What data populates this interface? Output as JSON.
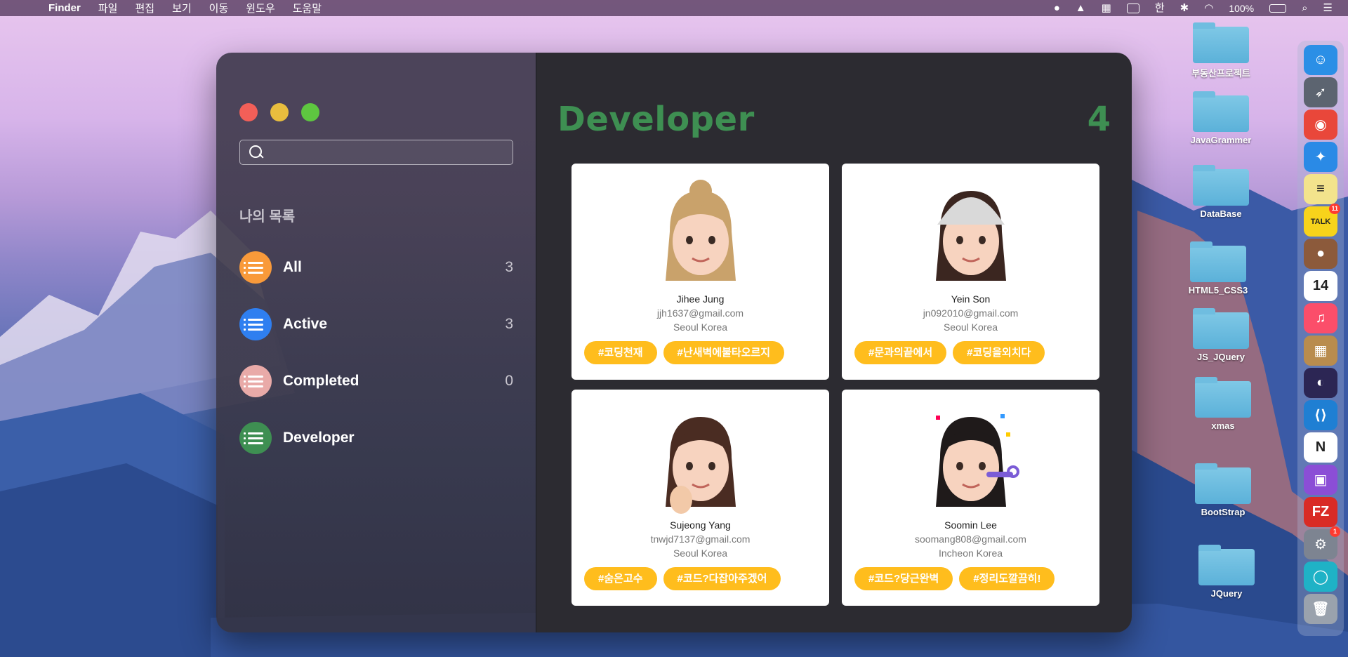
{
  "menubar": {
    "app_name": "Finder",
    "menus": [
      "파일",
      "편집",
      "보기",
      "이동",
      "윈도우",
      "도움말"
    ],
    "status": {
      "input_method": "한",
      "battery": "100%"
    }
  },
  "desktop": {
    "items": [
      {
        "label": "부동산프로젝트"
      },
      {
        "label": "JavaGrammer"
      },
      {
        "label": "DataBase"
      },
      {
        "label": "HTML5_CSS3"
      },
      {
        "label": "JS_JQuery"
      },
      {
        "label": "xmas"
      },
      {
        "label": "BootStrap"
      },
      {
        "label": "JQuery"
      }
    ]
  },
  "dock": {
    "apps": [
      {
        "name": "finder-icon",
        "color": "#2b8fe6",
        "glyph": "☺",
        "badge": ""
      },
      {
        "name": "launchpad-icon",
        "color": "#5c6470",
        "glyph": "➶",
        "badge": ""
      },
      {
        "name": "chrome-icon",
        "color": "#e9473a",
        "glyph": "◉",
        "badge": ""
      },
      {
        "name": "safari-icon",
        "color": "#2a8ae6",
        "glyph": "✦",
        "badge": ""
      },
      {
        "name": "notes-icon",
        "color": "#f3e38c",
        "glyph": "≡",
        "badge": ""
      },
      {
        "name": "kakaotalk-icon",
        "color": "#f7d31b",
        "glyph": "TALK",
        "badge": "11"
      },
      {
        "name": "photo-booth-icon",
        "color": "#8c5a3b",
        "glyph": "●",
        "badge": ""
      },
      {
        "name": "calendar-icon",
        "color": "#ffffff",
        "glyph": "14",
        "badge": ""
      },
      {
        "name": "music-icon",
        "color": "#fb4e6a",
        "glyph": "♫",
        "badge": ""
      },
      {
        "name": "archive-icon",
        "color": "#b98c4e",
        "glyph": "▦",
        "badge": ""
      },
      {
        "name": "eclipse-icon",
        "color": "#2c2654",
        "glyph": "◐",
        "badge": ""
      },
      {
        "name": "vscode-icon",
        "color": "#1f7fd3",
        "glyph": "⟨⟩",
        "badge": ""
      },
      {
        "name": "notion-icon",
        "color": "#ffffff",
        "glyph": "N",
        "badge": ""
      },
      {
        "name": "utility-icon",
        "color": "#8b4ed6",
        "glyph": "▣",
        "badge": ""
      },
      {
        "name": "filezilla-icon",
        "color": "#d92b25",
        "glyph": "FZ",
        "badge": ""
      },
      {
        "name": "system-preferences-icon",
        "color": "#7d8491",
        "glyph": "⚙",
        "badge": "1"
      },
      {
        "name": "messages-icon",
        "color": "#1fb2c6",
        "glyph": "◯",
        "badge": ""
      },
      {
        "name": "trash-icon",
        "color": "#9aa2ad",
        "glyph": "🗑",
        "badge": ""
      }
    ]
  },
  "app": {
    "search": {
      "value": "",
      "placeholder": ""
    },
    "lists_title": "나의 목록",
    "lists": [
      {
        "label": "All",
        "count": "3",
        "color": "#f99a3a"
      },
      {
        "label": "Active",
        "count": "3",
        "color": "#2f7ff0"
      },
      {
        "label": "Completed",
        "count": "0",
        "color": "#e9aaa8"
      },
      {
        "label": "Developer",
        "count": "",
        "color": "#3e8f52"
      }
    ],
    "main": {
      "title": "Developer",
      "count": "4",
      "title_color": "#3e8f52"
    },
    "cards": [
      {
        "name": "Jihee Jung",
        "email": "jjh1637@gmail.com",
        "location": "Seoul Korea",
        "tags": [
          "#코딩천재",
          "#난새벽에불타오르지"
        ]
      },
      {
        "name": "Yein Son",
        "email": "jn092010@gmail.com",
        "location": "Seoul Korea",
        "tags": [
          "#문과의끝에서",
          "#코딩을외치다"
        ]
      },
      {
        "name": "Sujeong Yang",
        "email": "tnwjd7137@gmail.com",
        "location": "Seoul Korea",
        "tags": [
          "#숨은고수",
          "#코드?다잡아주겠어"
        ]
      },
      {
        "name": "Soomin Lee",
        "email": "soomang808@gmail.com",
        "location": "Incheon Korea",
        "tags": [
          "#코드?당근완벽",
          "#정리도깔끔히!"
        ]
      }
    ],
    "tag_color": "#ffbd1d"
  }
}
